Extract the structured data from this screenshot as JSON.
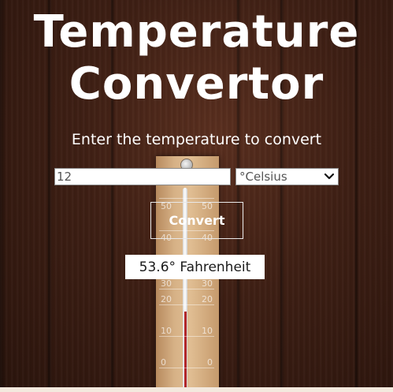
{
  "header": {
    "title_line1": "Temperature",
    "title_line2": "Convertor",
    "subtitle": "Enter the temperature to convert"
  },
  "form": {
    "temperature_value": "12",
    "unit_selected": "°Celsius",
    "convert_label": "Convert"
  },
  "result": {
    "text": "53.6° Fahrenheit"
  },
  "thermometer": {
    "scale": [
      "50",
      "40",
      "30",
      "20",
      "10",
      "0"
    ]
  },
  "colors": {
    "text": "#ffffff",
    "mercury": "#b1262a",
    "wood": "#3e1f14"
  }
}
